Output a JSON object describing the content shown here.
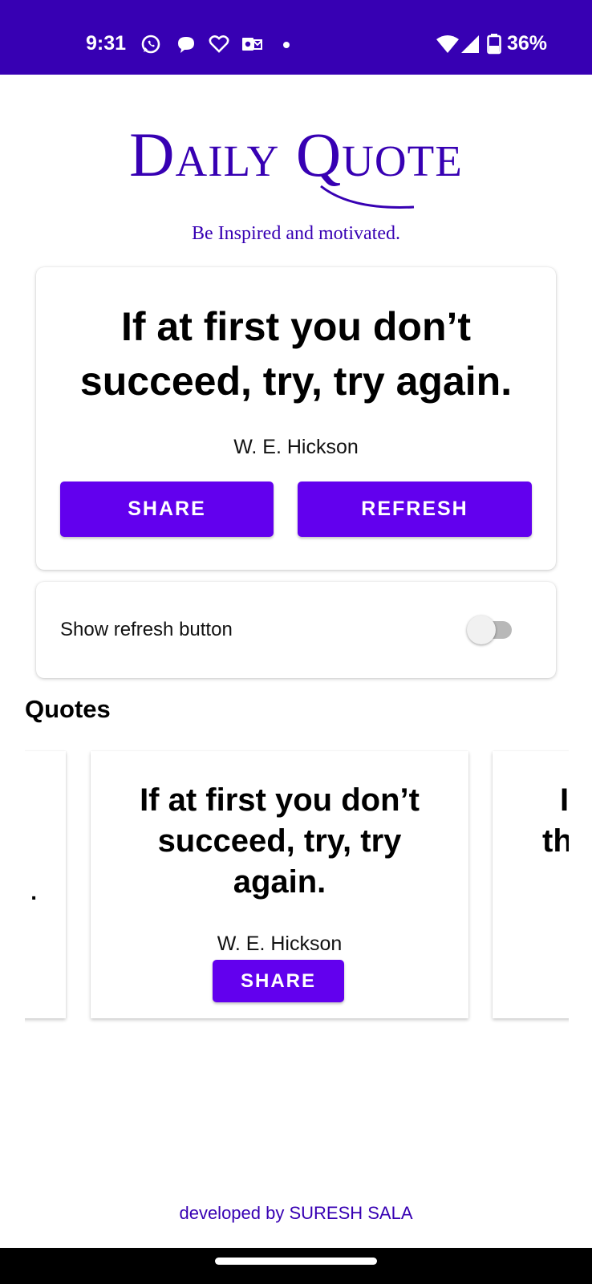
{
  "status_bar": {
    "time": "9:31",
    "battery": "36%",
    "background": "#3700B3",
    "icons": [
      "whatsapp-icon",
      "chat-bubble-icon",
      "heart-icon",
      "outlook-icon",
      "notification-dot-icon",
      "wifi-icon",
      "signal-icon",
      "battery-icon"
    ]
  },
  "header": {
    "title": "Daily Quote",
    "subtitle": "Be Inspired and motivated."
  },
  "main_card": {
    "quote": "If at first you don’t succeed, try, try again.",
    "author": "W. E. Hickson",
    "share_label": "SHARE",
    "refresh_label": "REFRESH"
  },
  "settings": {
    "refresh_toggle_label": "Show refresh button",
    "refresh_toggle_on": false
  },
  "quotes_section": {
    "title": "Quotes",
    "prev_card_fragment": ".",
    "current": {
      "quote": "If at first you don’t succeed, try, try again.",
      "author": "W. E. Hickson",
      "share_label": "SHARE"
    },
    "next_card_fragment_line1": "I",
    "next_card_fragment_line2": "th"
  },
  "footer": {
    "credit": "developed by SURESH SALA"
  },
  "colors": {
    "primary_dark": "#3700B3",
    "primary": "#6200EE"
  }
}
